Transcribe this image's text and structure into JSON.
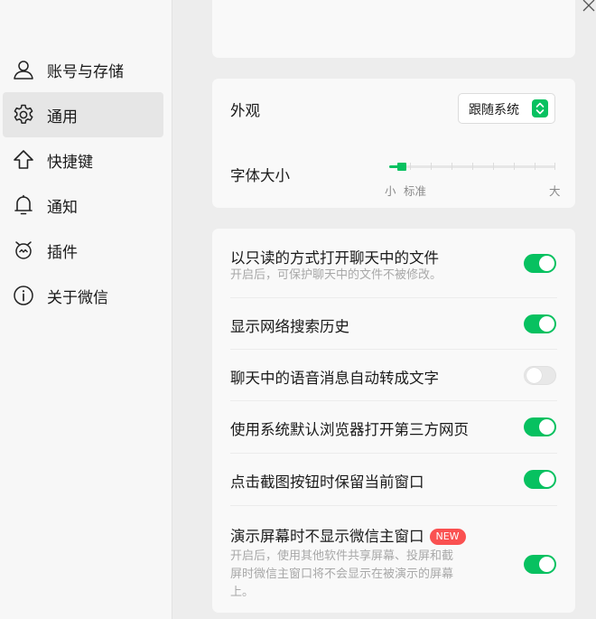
{
  "sidebar": {
    "items": [
      {
        "label": "账号与存储",
        "icon": "user-icon"
      },
      {
        "label": "通用",
        "icon": "gear-icon"
      },
      {
        "label": "快捷键",
        "icon": "arrow-up-icon"
      },
      {
        "label": "通知",
        "icon": "bell-icon"
      },
      {
        "label": "插件",
        "icon": "plugin-icon"
      },
      {
        "label": "关于微信",
        "icon": "info-icon"
      }
    ],
    "active": "通用"
  },
  "window": {
    "close_icon": "close-icon"
  },
  "appearance": {
    "label": "外观",
    "select_value": "跟随系统"
  },
  "font_size": {
    "label": "字体大小",
    "small": "小",
    "standard": "标准",
    "large": "大",
    "level": 0.07
  },
  "settings": [
    {
      "label": "以只读的方式打开聊天中的文件",
      "sub": "开启后，可保护聊天中的文件不被修改。",
      "on": true
    },
    {
      "label": "显示网络搜索历史",
      "on": true
    },
    {
      "label": "聊天中的语音消息自动转成文字",
      "on": false
    },
    {
      "label": "使用系统默认浏览器打开第三方网页",
      "on": true
    },
    {
      "label": "点击截图按钮时保留当前窗口",
      "on": true
    },
    {
      "label": "演示屏幕时不显示微信主窗口",
      "badge": "NEW",
      "sub_lines": [
        "开启后，使用其他软件共享屏幕、投屏和截",
        "屏时微信主窗口将不会显示在被演示的屏幕",
        "上。"
      ],
      "on": true
    }
  ],
  "colors": {
    "accent": "#07c160",
    "badge": "#fa5151"
  }
}
